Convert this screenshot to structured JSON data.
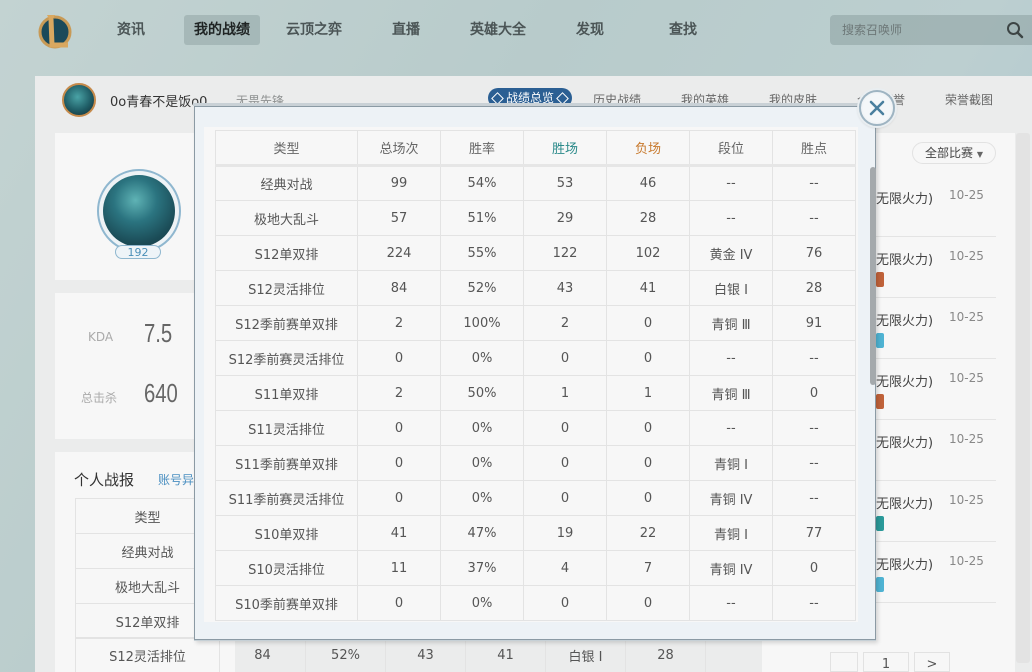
{
  "nav": {
    "items": [
      {
        "label": "资讯"
      },
      {
        "label": "我的战绩",
        "active": true
      },
      {
        "label": "云顶之弈"
      },
      {
        "label": "直播"
      },
      {
        "label": "英雄大全"
      },
      {
        "label": "发现"
      },
      {
        "label": "查找"
      }
    ],
    "search_placeholder": "搜索召唤师"
  },
  "profile": {
    "name": "0o青春不是饭o0",
    "title": "无畏先锋",
    "name_partial": "0c",
    "title_partial": "无畏",
    "level": "192"
  },
  "tabs": [
    {
      "label": "战绩总览",
      "active": true
    },
    {
      "label": "历史战绩"
    },
    {
      "label": "我的英雄"
    },
    {
      "label": "我的皮肤"
    },
    {
      "label": "个人荣誉"
    },
    {
      "label": "荣誉截图"
    }
  ],
  "stats": {
    "kda_label": "KDA",
    "kda_value": "7.5",
    "kills_label": "总击杀",
    "kills_value": "640"
  },
  "personal_report": {
    "title": "个人战报",
    "link": "账号异",
    "visible_rows": [
      "类型",
      "经典对战",
      "极地大乱斗",
      "S12单双排",
      "S12灵活排位"
    ],
    "bottom_row": [
      "S12灵活排位",
      "84",
      "52%",
      "43",
      "41",
      "白银 Ⅰ",
      "28"
    ]
  },
  "match_list": {
    "filter_label": "全部比赛",
    "items": [
      {
        "mode": "无限火力)",
        "date": "10-25",
        "tag_color": null
      },
      {
        "mode": "无限火力)",
        "date": "10-25",
        "tag_color": "#c0623a"
      },
      {
        "mode": "无限火力)",
        "date": "10-25",
        "tag_color": "#4fb3d3"
      },
      {
        "mode": "无限火力)",
        "date": "10-25",
        "tag_color": "#c0623a"
      },
      {
        "mode": "无限火力)",
        "date": "10-25",
        "tag_color": null
      },
      {
        "mode": "无限火力)",
        "date": "10-25",
        "tag_color": "#2a9a9a"
      },
      {
        "mode": "无限火力)",
        "date": "10-25",
        "tag_color": "#4fb3d3"
      }
    ],
    "page": "1",
    "next_label": ">"
  },
  "modal": {
    "columns": [
      "类型",
      "总场次",
      "胜率",
      "胜场",
      "负场",
      "段位",
      "胜点"
    ],
    "rows": [
      [
        "经典对战",
        "99",
        "54%",
        "53",
        "46",
        "--",
        "--"
      ],
      [
        "极地大乱斗",
        "57",
        "51%",
        "29",
        "28",
        "--",
        "--"
      ],
      [
        "S12单双排",
        "224",
        "55%",
        "122",
        "102",
        "黄金 IV",
        "76"
      ],
      [
        "S12灵活排位",
        "84",
        "52%",
        "43",
        "41",
        "白银 Ⅰ",
        "28"
      ],
      [
        "S12季前赛单双排",
        "2",
        "100%",
        "2",
        "0",
        "青铜 Ⅲ",
        "91"
      ],
      [
        "S12季前赛灵活排位",
        "0",
        "0%",
        "0",
        "0",
        "--",
        "--"
      ],
      [
        "S11单双排",
        "2",
        "50%",
        "1",
        "1",
        "青铜 Ⅲ",
        "0"
      ],
      [
        "S11灵活排位",
        "0",
        "0%",
        "0",
        "0",
        "--",
        "--"
      ],
      [
        "S11季前赛单双排",
        "0",
        "0%",
        "0",
        "0",
        "青铜 Ⅰ",
        "--"
      ],
      [
        "S11季前赛灵活排位",
        "0",
        "0%",
        "0",
        "0",
        "青铜 IV",
        "--"
      ],
      [
        "S10单双排",
        "41",
        "47%",
        "19",
        "22",
        "青铜 Ⅰ",
        "77"
      ],
      [
        "S10灵活排位",
        "11",
        "37%",
        "4",
        "7",
        "青铜 IV",
        "0"
      ],
      [
        "S10季前赛单双排",
        "0",
        "0%",
        "0",
        "0",
        "--",
        "--"
      ]
    ]
  }
}
